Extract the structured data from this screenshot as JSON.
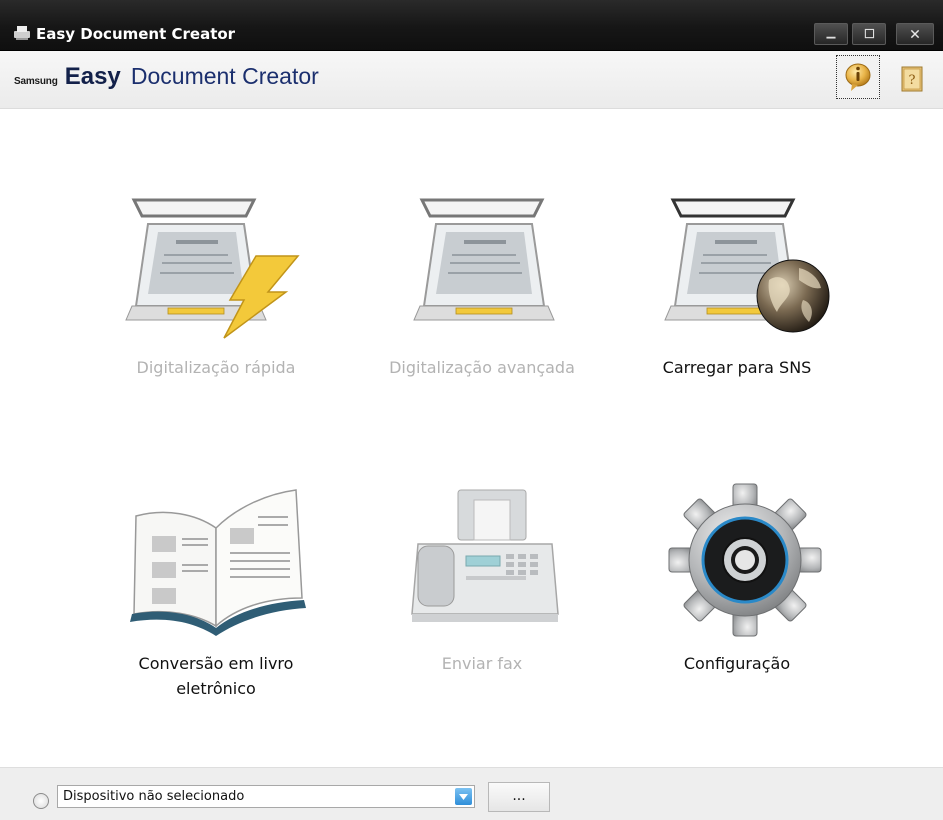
{
  "window": {
    "title": "Easy Document Creator",
    "controls": {
      "minimize": "_",
      "maximize": "□",
      "close": "×"
    }
  },
  "header": {
    "brand_samsung": "Samsung",
    "brand_easy": "Easy",
    "brand_rest": "Document Creator",
    "info_icon": "info-bubble-icon",
    "help_icon": "help-book-icon"
  },
  "tiles": [
    {
      "label": "Digitalização rápida",
      "enabled": false,
      "icon": "scanner-lightning-icon"
    },
    {
      "label": "Digitalização avançada",
      "enabled": false,
      "icon": "scanner-icon"
    },
    {
      "label": "Carregar para SNS",
      "enabled": true,
      "icon": "scanner-globe-icon"
    },
    {
      "label_line1": "Conversão em livro",
      "label_line2": "eletrônico",
      "enabled": true,
      "icon": "open-book-icon"
    },
    {
      "label": "Enviar fax",
      "enabled": false,
      "icon": "fax-machine-icon"
    },
    {
      "label": "Configuração",
      "enabled": true,
      "icon": "gear-icon"
    }
  ],
  "footer": {
    "device_select_value": "Dispositivo não selecionado",
    "more_button_label": "..."
  },
  "colors": {
    "titlebar": "#161616",
    "brand_blue": "#1b2f6e",
    "disabled_text": "#b3b3b3",
    "dropdown_blue": "#2f8ed9"
  }
}
